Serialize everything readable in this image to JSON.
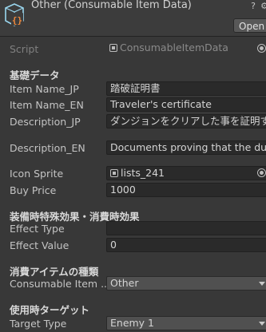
{
  "header": {
    "title": "Other (Consumable Item Data)",
    "open_label": "Open"
  },
  "script": {
    "label": "Script",
    "value": "ConsumableItemData"
  },
  "sections": {
    "basic": "基礎データ",
    "equip": "装備時特殊効果・消費時効果",
    "consumable": "消費アイテムの種類",
    "target": "使用時ターゲット"
  },
  "fields": {
    "item_name_jp": {
      "label": "Item Name_JP",
      "value": "踏破証明書"
    },
    "item_name_en": {
      "label": "Item Name_EN",
      "value": "Traveler's certificate"
    },
    "description_jp": {
      "label": "Description_JP",
      "value": "ダンジョンをクリアした事を証明する書類"
    },
    "description_en": {
      "label": "Description_EN",
      "value": "Documents proving that the dunge"
    },
    "icon_sprite": {
      "label": "Icon Sprite",
      "value": "lists_241"
    },
    "buy_price": {
      "label": "Buy Price",
      "value": "1000"
    },
    "effect_type": {
      "label": "Effect Type",
      "value": ""
    },
    "effect_value": {
      "label": "Effect Value",
      "value": "0"
    },
    "consumable_item": {
      "label": "Consumable Item ...",
      "value": "Other"
    },
    "target_type": {
      "label": "Target Type",
      "value": "Enemy 1"
    }
  }
}
